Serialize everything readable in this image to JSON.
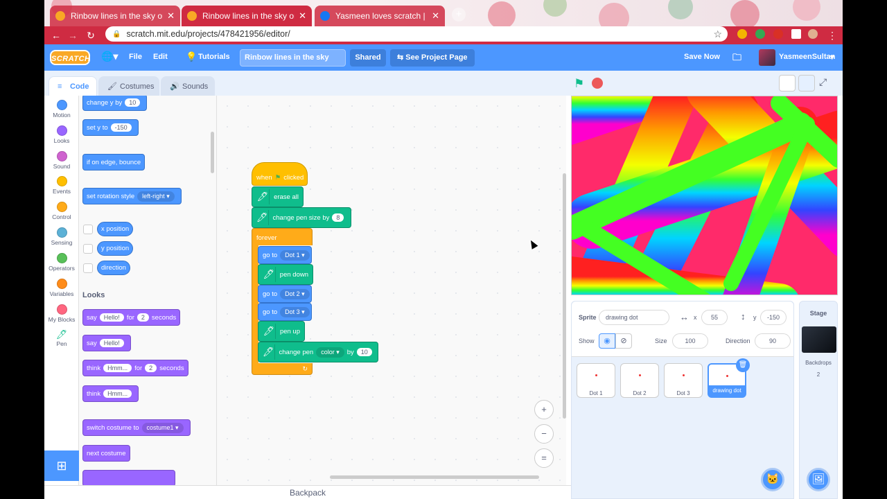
{
  "browser": {
    "tabs": [
      {
        "title": "Rinbow lines in the sky on Scratc",
        "close": "✕"
      },
      {
        "title": "Rinbow lines in the sky on Scratc",
        "close": "✕"
      },
      {
        "title": "Yasmeen loves scratch | Facebo",
        "close": "✕"
      }
    ],
    "new_tab": "+",
    "url": "scratch.mit.edu/projects/478421956/editor/"
  },
  "menu": {
    "logo": "SCRATCH",
    "file": "File",
    "edit": "Edit",
    "tutorials": "Tutorials",
    "project_title": "Rinbow lines in the sky",
    "shared": "Shared",
    "see_project_page": "See Project Page",
    "save_now": "Save Now",
    "username": "YasmeenSultan"
  },
  "editor_tabs": {
    "code": "Code",
    "costumes": "Costumes",
    "sounds": "Sounds"
  },
  "categories": [
    {
      "label": "Motion",
      "color": "#4c97ff"
    },
    {
      "label": "Looks",
      "color": "#9966ff"
    },
    {
      "label": "Sound",
      "color": "#cf63cf"
    },
    {
      "label": "Events",
      "color": "#ffbf00"
    },
    {
      "label": "Control",
      "color": "#ffab19"
    },
    {
      "label": "Sensing",
      "color": "#5cb1d6"
    },
    {
      "label": "Operators",
      "color": "#59c059"
    },
    {
      "label": "Variables",
      "color": "#ff8c1a"
    },
    {
      "label": "My Blocks",
      "color": "#ff6680"
    },
    {
      "label": "Pen",
      "color": "#0fbd8c"
    }
  ],
  "palette": {
    "change_y": {
      "label": "change y by",
      "value": "10"
    },
    "set_y": {
      "label": "set y to",
      "value": "-150"
    },
    "bounce": "if on edge, bounce",
    "rotation": {
      "label": "set rotation style",
      "value": "left-right"
    },
    "reporters": [
      "x position",
      "y position",
      "direction"
    ],
    "looks_heading": "Looks",
    "say_for": {
      "label": "say",
      "msg": "Hello!",
      "for": "for",
      "secs": "2",
      "unit": "seconds"
    },
    "say": {
      "label": "say",
      "msg": "Hello!"
    },
    "think_for": {
      "label": "think",
      "msg": "Hmm...",
      "for": "for",
      "secs": "2",
      "unit": "seconds"
    },
    "think": {
      "label": "think",
      "msg": "Hmm..."
    },
    "switch_costume": {
      "label": "switch costume to",
      "value": "costume1"
    },
    "next_costume": "next costume"
  },
  "script": {
    "hat": {
      "when": "when",
      "clicked": "clicked"
    },
    "erase_all": "erase all",
    "pen_size": {
      "label": "change pen size by",
      "value": "8"
    },
    "forever": "forever",
    "goto1": {
      "label": "go to",
      "value": "Dot 1"
    },
    "pen_down": "pen down",
    "goto2": {
      "label": "go to",
      "value": "Dot 2"
    },
    "goto3": {
      "label": "go to",
      "value": "Dot 3"
    },
    "pen_up": "pen up",
    "change_pen": {
      "label": "change pen",
      "param": "color",
      "by": "by",
      "value": "10"
    }
  },
  "zoom": {
    "in": "+",
    "out": "−",
    "reset": "="
  },
  "backpack": "Backpack",
  "sprite_info": {
    "sprite_label": "Sprite",
    "sprite_name": "drawing dot",
    "x_label": "x",
    "x": "55",
    "y_label": "y",
    "y": "-150",
    "show_label": "Show",
    "size_label": "Size",
    "size": "100",
    "direction_label": "Direction",
    "direction": "90"
  },
  "sprites": [
    "Dot 1",
    "Dot 2",
    "Dot 3",
    "drawing dot"
  ],
  "stage_panel": {
    "title": "Stage",
    "backdrops_label": "Backdrops",
    "backdrops_count": "2"
  }
}
